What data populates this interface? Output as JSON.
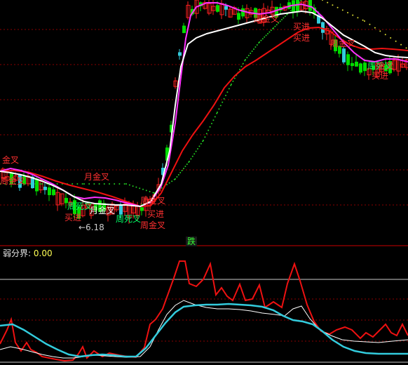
{
  "chart_data": [
    {
      "type": "candlestick",
      "panel": "main",
      "annotations": [
        {
          "text": "周金叉",
          "color": "#ff3030"
        },
        {
          "text": "买进",
          "color": "#ff3030"
        },
        {
          "text": "周金叉",
          "color": "#ff3030"
        },
        {
          "text": "金叉",
          "color": "#ff3030"
        },
        {
          "text": "月金叉",
          "color": "#ff3030"
        },
        {
          "text": "周金叉",
          "color": "#ff3030"
        },
        {
          "text": "月金叉",
          "color": "#ffffff"
        },
        {
          "text": "周死叉",
          "color": "#00ff66"
        },
        {
          "text": "周金叉",
          "color": "#ff3030"
        },
        {
          "text": "买进",
          "color": "#ff3030"
        },
        {
          "text": "周金叉",
          "color": "#ff3030"
        },
        {
          "text": "←6.18",
          "color": "#cccccc"
        },
        {
          "text": "买进",
          "color": "#ff3030"
        },
        {
          "text": "周死叉",
          "color": "#00ff66"
        },
        {
          "text": "买进",
          "color": "#ff3030"
        },
        {
          "text": "周死叉",
          "color": "#00ff66"
        },
        {
          "text": "金叉",
          "color": "#ff3030"
        },
        {
          "text": "买进",
          "color": "#ff3030"
        }
      ]
    },
    {
      "type": "line",
      "panel": "indicator",
      "label": "弱分界:",
      "label_value": "0.00"
    }
  ],
  "tab": {
    "label": "跌"
  },
  "colors": {
    "background": "#000000",
    "grid": "#8b0000",
    "up": "#ff2020",
    "down": "#00dd00",
    "ma_white": "#ffffff",
    "ma_magenta": "#ff33ff",
    "ma_red": "#ee1111",
    "cyan": "#33ccdd",
    "dots": "#22cc22"
  }
}
